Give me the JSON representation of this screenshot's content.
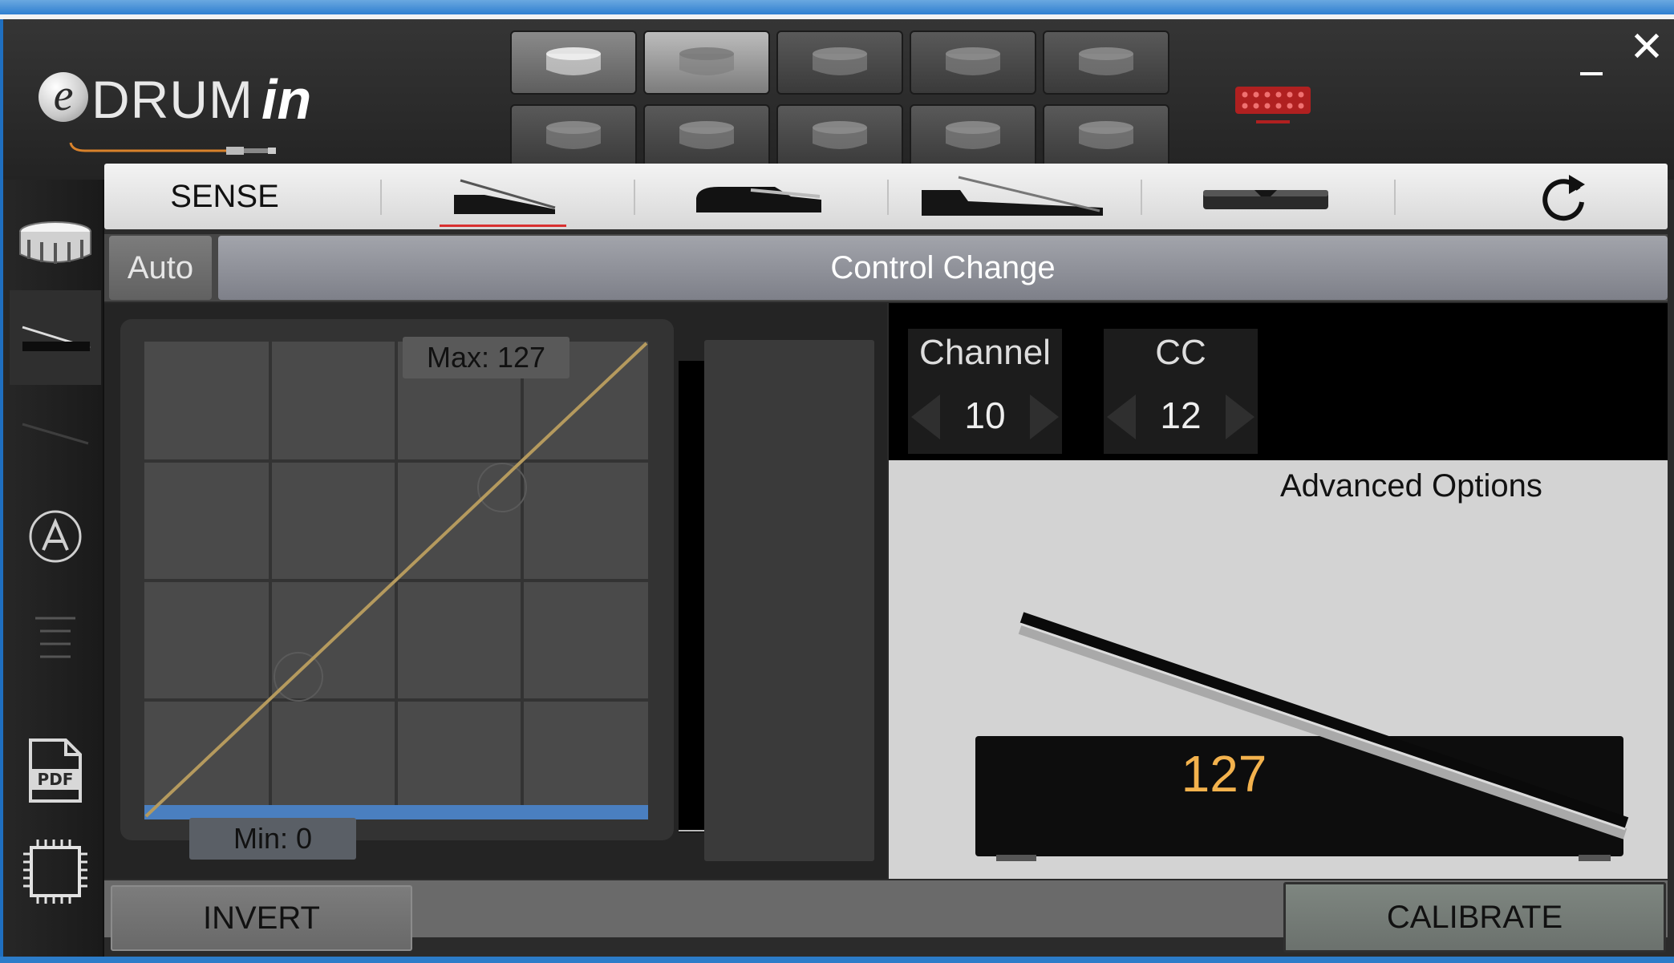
{
  "app": {
    "logo_prefix": "e",
    "logo_main": "DRUM",
    "logo_suffix": "in"
  },
  "window_controls": {
    "close_glyph": "✕"
  },
  "pads": {
    "count": 10,
    "selected_index": 1,
    "highlighted_index": 0
  },
  "tabs": {
    "sense_label": "SENSE",
    "items": [
      "hihat-pedal-icon",
      "sustain-pedal-icon",
      "expression-pedal-icon",
      "switch-pedal-icon"
    ],
    "active_index": 0
  },
  "mode": {
    "auto_label": "Auto",
    "mode_label": "Control Change"
  },
  "curve": {
    "max_label": "Max: 127",
    "min_label": "Min: 0"
  },
  "channel": {
    "label": "Channel",
    "value": "10"
  },
  "cc": {
    "label": "CC",
    "value": "12"
  },
  "advanced": {
    "title": "Advanced Options",
    "pedal_value": "127"
  },
  "footer": {
    "invert_label": "INVERT",
    "calibrate_label": "CALIBRATE"
  },
  "colors": {
    "accent_red": "#d93030",
    "curve_gold": "#b59a5e",
    "value_orange": "#f3b24d",
    "min_bar_blue": "#4a7fc0"
  }
}
